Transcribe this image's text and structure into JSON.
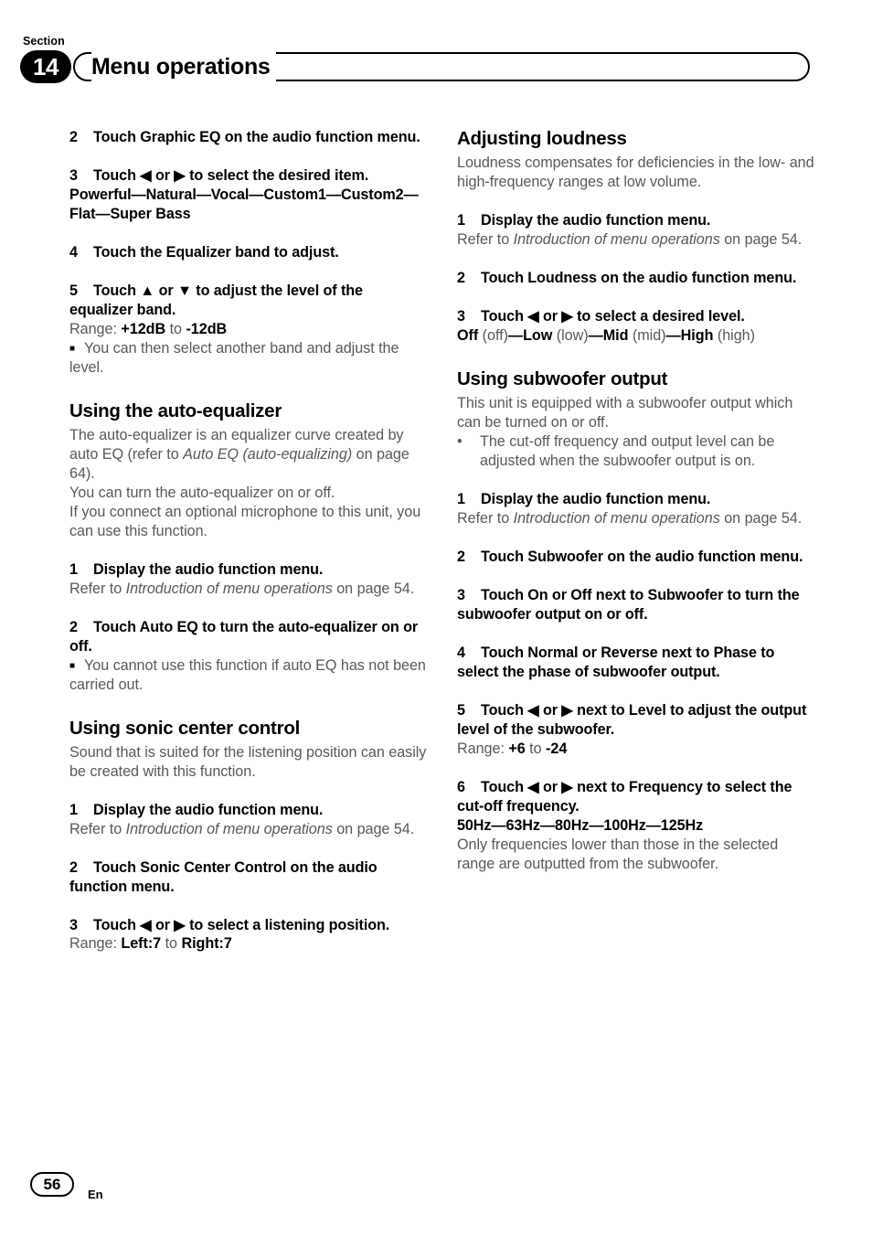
{
  "header": {
    "section_label": "Section",
    "section_number": "14",
    "title": "Menu operations"
  },
  "footer": {
    "page_number": "56",
    "language_code": "En"
  },
  "left_column": {
    "eq_step2": {
      "num": "2",
      "text": "Touch Graphic EQ on the audio function menu."
    },
    "eq_step3": {
      "num": "3",
      "text": "Touch ◀ or ▶ to select the desired item.",
      "options": "Powerful—Natural—Vocal—Custom1—Custom2—Flat—Super Bass"
    },
    "eq_step4": {
      "num": "4",
      "text": "Touch the Equalizer band to adjust."
    },
    "eq_step5": {
      "num": "5",
      "text": "Touch ▲ or ▼ to adjust the level of the equalizer band.",
      "range_label": "Range:",
      "range_from": "+12dB",
      "range_to_word": "to",
      "range_to": "-12dB",
      "note": "You can then select another band and adjust the level."
    },
    "auto_eq": {
      "heading": "Using the auto-equalizer",
      "intro_a": "The auto-equalizer is an equalizer curve created by auto EQ (refer to ",
      "intro_a_italic": "Auto EQ (auto-equalizing)",
      "intro_a_end": " on page 64).",
      "intro_b": "You can turn the auto-equalizer on or off.",
      "intro_c": "If you connect an optional microphone to this unit, you can use this function.",
      "step1": {
        "num": "1",
        "text": "Display the audio function menu.",
        "refer_pre": "Refer to ",
        "refer_italic": "Introduction of menu operations",
        "refer_post": " on page 54."
      },
      "step2": {
        "num": "2",
        "text": "Touch Auto EQ to turn the auto-equalizer on or off.",
        "note": "You cannot use this function if auto EQ has not been carried out."
      }
    },
    "sonic_center": {
      "heading": "Using sonic center control",
      "intro": "Sound that is suited for the listening position can easily be created with this function.",
      "step1": {
        "num": "1",
        "text": "Display the audio function menu.",
        "refer_pre": "Refer to ",
        "refer_italic": "Introduction of menu operations",
        "refer_post": " on page 54."
      },
      "step2": {
        "num": "2",
        "text": "Touch Sonic Center Control on the audio function menu."
      },
      "step3": {
        "num": "3",
        "text": "Touch ◀ or ▶ to select a listening position.",
        "range_label": "Range:",
        "range_from": "Left:7",
        "range_to_word": "to",
        "range_to": "Right:7"
      }
    }
  },
  "right_column": {
    "loudness": {
      "heading": "Adjusting loudness",
      "intro": "Loudness compensates for deficiencies in the low- and high-frequency ranges at low volume.",
      "step1": {
        "num": "1",
        "text": "Display the audio function menu.",
        "refer_pre": "Refer to ",
        "refer_italic": "Introduction of menu operations",
        "refer_post": " on page 54."
      },
      "step2": {
        "num": "2",
        "text": "Touch Loudness on the audio function menu."
      },
      "step3": {
        "num": "3",
        "text": "Touch ◀ or ▶ to select a desired level.",
        "levels": [
          {
            "bold": "Off",
            "plain": " (off)"
          },
          {
            "bold": "Low",
            "plain": " (low)"
          },
          {
            "bold": "Mid",
            "plain": " (mid)"
          },
          {
            "bold": "High",
            "plain": " (high)"
          }
        ],
        "separator": "—"
      }
    },
    "subwoofer": {
      "heading": "Using subwoofer output",
      "intro": "This unit is equipped with a subwoofer output which can be turned on or off.",
      "bullet": "The cut-off frequency and output level can be adjusted when the subwoofer output is on.",
      "step1": {
        "num": "1",
        "text": "Display the audio function menu.",
        "refer_pre": "Refer to ",
        "refer_italic": "Introduction of menu operations",
        "refer_post": " on page 54."
      },
      "step2": {
        "num": "2",
        "text": "Touch Subwoofer on the audio function menu."
      },
      "step3": {
        "num": "3",
        "text": "Touch On or Off next to Subwoofer to turn the subwoofer output on or off."
      },
      "step4": {
        "num": "4",
        "text": "Touch Normal or Reverse next to Phase to select the phase of subwoofer output."
      },
      "step5": {
        "num": "5",
        "text": "Touch ◀ or ▶ next to Level to adjust the output level of the subwoofer.",
        "range_label": "Range:",
        "range_from": "+6",
        "range_to_word": "to",
        "range_to": "-24"
      },
      "step6": {
        "num": "6",
        "text": "Touch ◀ or ▶ next to Frequency to select the cut-off frequency.",
        "frequencies": "50Hz—63Hz—80Hz—100Hz—125Hz",
        "note": "Only frequencies lower than those in the selected range are outputted from the subwoofer."
      }
    }
  }
}
